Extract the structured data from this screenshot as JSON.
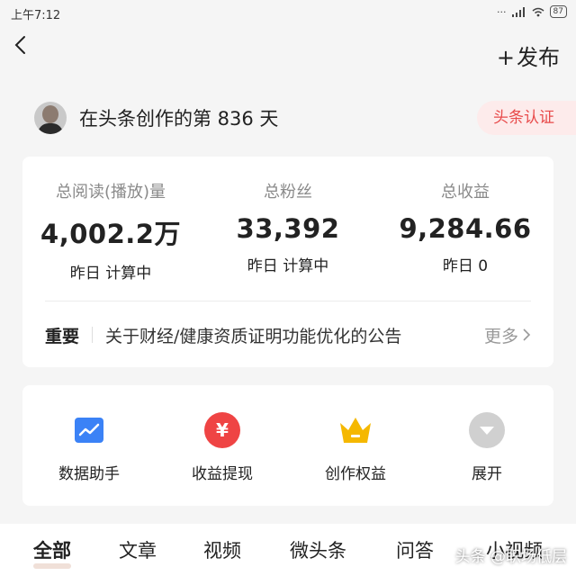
{
  "status": {
    "time": "上午7:12",
    "battery": "87"
  },
  "header": {
    "publish_plus": "+",
    "publish_label": "发布"
  },
  "profile": {
    "text": "在头条创作的第 836 天",
    "badge": "头条认证"
  },
  "stats": [
    {
      "label": "总阅读(播放)量",
      "value": "4,002.2万",
      "sub": "昨日 计算中"
    },
    {
      "label": "总粉丝",
      "value": "33,392",
      "sub": "昨日 计算中"
    },
    {
      "label": "总收益",
      "value": "9,284.66",
      "sub": "昨日 0"
    }
  ],
  "notice": {
    "tag": "重要",
    "text": "关于财经/健康资质证明功能优化的公告",
    "more": "更多"
  },
  "tools": [
    {
      "label": "数据助手",
      "icon": "chart-icon",
      "color": "#3b82f6"
    },
    {
      "label": "收益提现",
      "icon": "yuan-icon",
      "color": "#ef4444"
    },
    {
      "label": "创作权益",
      "icon": "crown-icon",
      "color": "#f5b800"
    },
    {
      "label": "展开",
      "icon": "expand-icon",
      "color": "#cfcfcf"
    }
  ],
  "tabs": [
    "全部",
    "文章",
    "视频",
    "微头条",
    "问答",
    "小视频"
  ],
  "watermark": "头条 @职场低层"
}
